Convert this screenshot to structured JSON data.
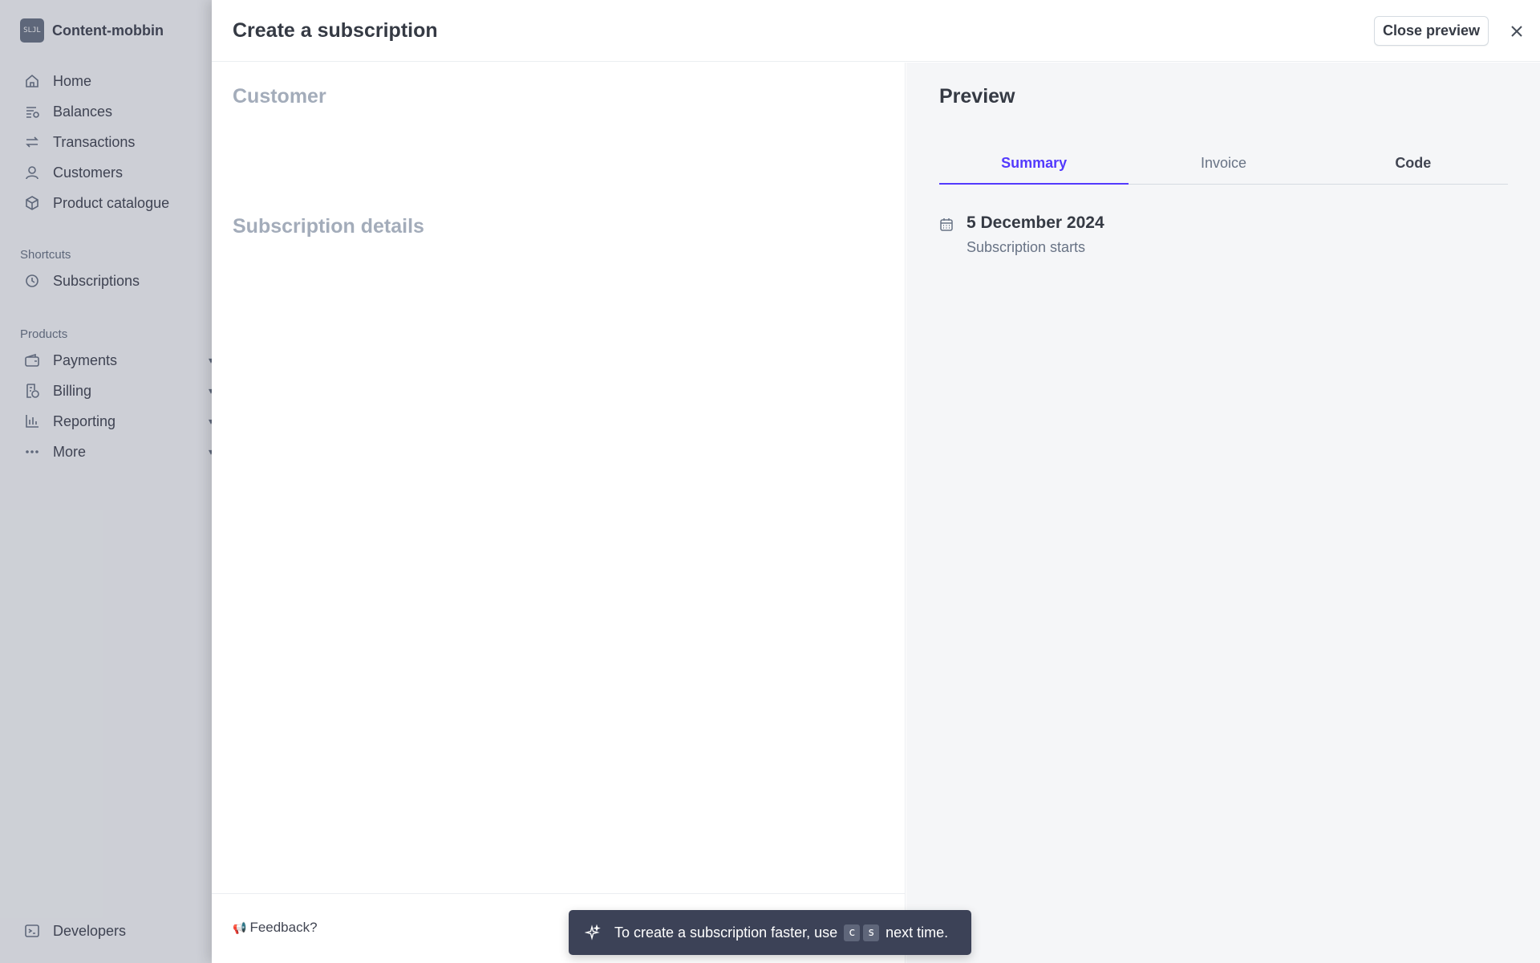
{
  "sidebar": {
    "account_logo": "SLJL",
    "account_name": "Content-mobbin",
    "nav": [
      {
        "label": "Home",
        "icon": "home-icon"
      },
      {
        "label": "Balances",
        "icon": "balances-icon"
      },
      {
        "label": "Transactions",
        "icon": "transactions-icon"
      },
      {
        "label": "Customers",
        "icon": "customer-icon"
      },
      {
        "label": "Product catalogue",
        "icon": "box-icon"
      }
    ],
    "shortcuts_label": "Shortcuts",
    "shortcuts": [
      {
        "label": "Subscriptions",
        "icon": "clock-icon"
      }
    ],
    "products_label": "Products",
    "products": [
      {
        "label": "Payments",
        "icon": "wallet-icon"
      },
      {
        "label": "Billing",
        "icon": "billing-icon"
      },
      {
        "label": "Reporting",
        "icon": "bar-chart-icon"
      },
      {
        "label": "More",
        "icon": "more-icon"
      }
    ],
    "developers": {
      "label": "Developers",
      "icon": "terminal-icon"
    }
  },
  "modal": {
    "title": "Create a subscription",
    "close_preview_label": "Close preview",
    "left": {
      "customer_heading": "Customer",
      "subscription_details_heading": "Subscription details",
      "feedback_label": "Feedback?"
    },
    "preview": {
      "title": "Preview",
      "tabs": [
        {
          "label": "Summary",
          "active": true
        },
        {
          "label": "Invoice",
          "active": false
        },
        {
          "label": "Code",
          "active": false
        }
      ],
      "summary": {
        "date": "5 December 2024",
        "subtitle": "Subscription starts"
      }
    }
  },
  "toast": {
    "text_before": "To create a subscription faster, use",
    "keys": [
      "c",
      "s"
    ],
    "text_after": "next time."
  },
  "colors": {
    "accent": "#533afd",
    "toast_bg": "#3c4257",
    "preview_bg": "#f5f6f8"
  }
}
